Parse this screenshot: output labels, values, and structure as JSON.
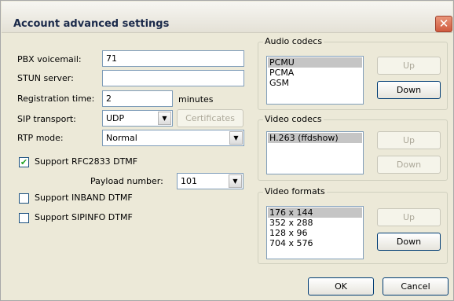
{
  "window": {
    "title": "Account advanced settings",
    "close": "✕"
  },
  "left": {
    "pbx_voicemail": {
      "label": "PBX voicemail:",
      "value": "71"
    },
    "stun_server": {
      "label": "STUN server:",
      "value": ""
    },
    "registration_time": {
      "label": "Registration time:",
      "value": "2",
      "unit": "minutes"
    },
    "sip_transport": {
      "label": "SIP transport:",
      "value": "UDP"
    },
    "certificates_button": "Certificates",
    "rtp_mode": {
      "label": "RTP mode:",
      "value": "Normal"
    },
    "rfc2833": {
      "label": "Support RFC2833 DTMF",
      "checked": true,
      "mark": "✔"
    },
    "payload_number": {
      "label": "Payload number:",
      "value": "101"
    },
    "inband": {
      "label": "Support INBAND DTMF",
      "checked": false
    },
    "sipinfo": {
      "label": "Support SIPINFO DTMF",
      "checked": false
    }
  },
  "audio_codecs": {
    "title": "Audio codecs",
    "items": [
      "PCMU",
      "PCMA",
      "GSM"
    ],
    "selected_index": 0,
    "up": "Up",
    "down": "Down"
  },
  "video_codecs": {
    "title": "Video codecs",
    "items": [
      "H.263 (ffdshow)"
    ],
    "selected_index": 0,
    "up": "Up",
    "down": "Down"
  },
  "video_formats": {
    "title": "Video formats",
    "items": [
      "176 x 144",
      "352 x 288",
      "128 x 96",
      "704 x 576"
    ],
    "selected_index": 0,
    "up": "Up",
    "down": "Down"
  },
  "footer": {
    "ok": "OK",
    "cancel": "Cancel"
  },
  "icons": {
    "dropdown_arrow": "▼"
  }
}
